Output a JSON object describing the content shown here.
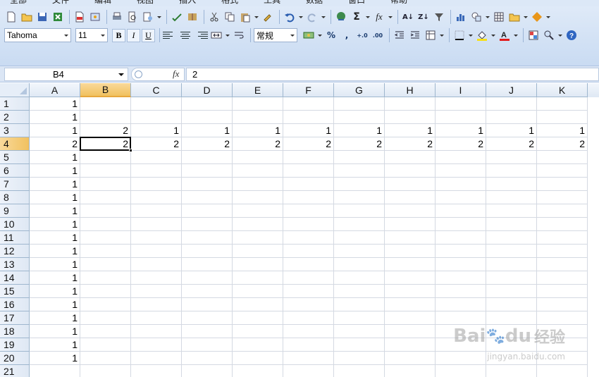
{
  "menu": [
    "全部",
    "文件",
    "编辑",
    "视图",
    "插入",
    "格式",
    "工具",
    "数据",
    "窗口",
    "帮助"
  ],
  "toolbar": {
    "font_name": "Tahoma",
    "font_size": "11",
    "bold": "B",
    "italic": "I",
    "underline": "U",
    "number_format": "常规",
    "percent": "%",
    "comma": ",",
    "inc_decimal": "+.0",
    "dec_decimal": ".00"
  },
  "formula_bar": {
    "name_box": "B4",
    "fx_label": "fx",
    "value": "2"
  },
  "columns": [
    "A",
    "B",
    "C",
    "D",
    "E",
    "F",
    "G",
    "H",
    "I",
    "J",
    "K"
  ],
  "rows": [
    "1",
    "2",
    "3",
    "4",
    "5",
    "6",
    "7",
    "8",
    "9",
    "10",
    "11",
    "12",
    "13",
    "14",
    "15",
    "16",
    "17",
    "18",
    "19",
    "20",
    "21"
  ],
  "cells": {
    "A": [
      "1",
      "1",
      "1",
      "2",
      "1",
      "1",
      "1",
      "1",
      "1",
      "1",
      "1",
      "1",
      "1",
      "1",
      "1",
      "1",
      "1",
      "1",
      "1",
      "1",
      ""
    ],
    "B": [
      "",
      "",
      "2",
      "2",
      "",
      "",
      "",
      "",
      "",
      "",
      "",
      "",
      "",
      "",
      "",
      "",
      "",
      "",
      "",
      "",
      ""
    ],
    "C": [
      "",
      "",
      "1",
      "2",
      "",
      "",
      "",
      "",
      "",
      "",
      "",
      "",
      "",
      "",
      "",
      "",
      "",
      "",
      "",
      "",
      ""
    ],
    "D": [
      "",
      "",
      "1",
      "2",
      "",
      "",
      "",
      "",
      "",
      "",
      "",
      "",
      "",
      "",
      "",
      "",
      "",
      "",
      "",
      "",
      ""
    ],
    "E": [
      "",
      "",
      "1",
      "2",
      "",
      "",
      "",
      "",
      "",
      "",
      "",
      "",
      "",
      "",
      "",
      "",
      "",
      "",
      "",
      "",
      ""
    ],
    "F": [
      "",
      "",
      "1",
      "2",
      "",
      "",
      "",
      "",
      "",
      "",
      "",
      "",
      "",
      "",
      "",
      "",
      "",
      "",
      "",
      "",
      ""
    ],
    "G": [
      "",
      "",
      "1",
      "2",
      "",
      "",
      "",
      "",
      "",
      "",
      "",
      "",
      "",
      "",
      "",
      "",
      "",
      "",
      "",
      "",
      ""
    ],
    "H": [
      "",
      "",
      "1",
      "2",
      "",
      "",
      "",
      "",
      "",
      "",
      "",
      "",
      "",
      "",
      "",
      "",
      "",
      "",
      "",
      "",
      ""
    ],
    "I": [
      "",
      "",
      "1",
      "2",
      "",
      "",
      "",
      "",
      "",
      "",
      "",
      "",
      "",
      "",
      "",
      "",
      "",
      "",
      "",
      "",
      ""
    ],
    "J": [
      "",
      "",
      "1",
      "2",
      "",
      "",
      "",
      "",
      "",
      "",
      "",
      "",
      "",
      "",
      "",
      "",
      "",
      "",
      "",
      "",
      ""
    ],
    "K": [
      "",
      "",
      "1",
      "2",
      "",
      "",
      "",
      "",
      "",
      "",
      "",
      "",
      "",
      "",
      "",
      "",
      "",
      "",
      "",
      "",
      ""
    ]
  },
  "selected": {
    "column": "B",
    "row": "4"
  },
  "watermark": {
    "brand": "Bai",
    "brand2": "du",
    "cn": "经验",
    "url": "jingyan.baidu.com"
  }
}
